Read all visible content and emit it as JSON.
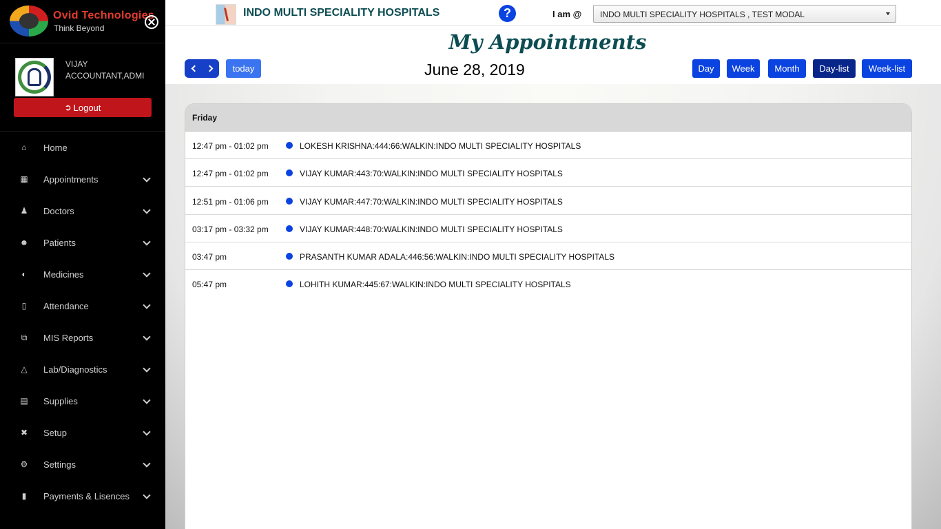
{
  "brand": {
    "name": "Ovid Technologies",
    "tagline": "Think Beyond"
  },
  "user": {
    "name": "VIJAY",
    "role": "ACCOUNTANT,ADMI",
    "logout_label": "Logout"
  },
  "nav": [
    {
      "label": "Home",
      "icon": "home-icon"
    },
    {
      "label": "Appointments",
      "icon": "calendar-icon"
    },
    {
      "label": "Doctors",
      "icon": "doctor-icon"
    },
    {
      "label": "Patients",
      "icon": "users-icon"
    },
    {
      "label": "Medicines",
      "icon": "pills-icon"
    },
    {
      "label": "Attendance",
      "icon": "book-icon"
    },
    {
      "label": "MIS Reports",
      "icon": "copy-icon"
    },
    {
      "label": "Lab/Diagnostics",
      "icon": "flask-icon"
    },
    {
      "label": "Supplies",
      "icon": "warehouse-icon"
    },
    {
      "label": "Setup",
      "icon": "tools-icon"
    },
    {
      "label": "Settings",
      "icon": "gear-icon"
    },
    {
      "label": "Payments & Lisences",
      "icon": "id-badge-icon"
    }
  ],
  "topbar": {
    "hospital_name": "INDO MULTI SPECIALITY HOSPITALS",
    "help": "?",
    "iam_label": "I am @",
    "iam_value": "INDO MULTI SPECIALITY HOSPITALS , TEST MODAL"
  },
  "page": {
    "title": "My Appointments",
    "date": "June 28, 2019"
  },
  "toolbar": {
    "today": "today",
    "views": [
      "Day",
      "Week",
      "Month",
      "Day-list",
      "Week-list"
    ],
    "active_view": "Day-list"
  },
  "calendar": {
    "day_label": "Friday",
    "events": [
      {
        "time": "12:47 pm - 01:02 pm",
        "title": "LOKESH KRISHNA:444:66:WALKIN:INDO MULTI SPECIALITY HOSPITALS"
      },
      {
        "time": "12:47 pm - 01:02 pm",
        "title": "VIJAY KUMAR:443:70:WALKIN:INDO MULTI SPECIALITY HOSPITALS"
      },
      {
        "time": "12:51 pm - 01:06 pm",
        "title": "VIJAY KUMAR:447:70:WALKIN:INDO MULTI SPECIALITY HOSPITALS"
      },
      {
        "time": "03:17 pm - 03:32 pm",
        "title": "VIJAY KUMAR:448:70:WALKIN:INDO MULTI SPECIALITY HOSPITALS"
      },
      {
        "time": "03:47 pm",
        "title": "PRASANTH KUMAR ADALA:446:56:WALKIN:INDO MULTI SPECIALITY HOSPITALS"
      },
      {
        "time": "05:47 pm",
        "title": "LOHITH KUMAR:445:67:WALKIN:INDO MULTI SPECIALITY HOSPITALS"
      }
    ]
  },
  "colors": {
    "sidebar_bg": "#000000",
    "primary": "#0a43e0",
    "active": "#08268a",
    "logout": "#c0151b",
    "title": "#0d4d52"
  }
}
